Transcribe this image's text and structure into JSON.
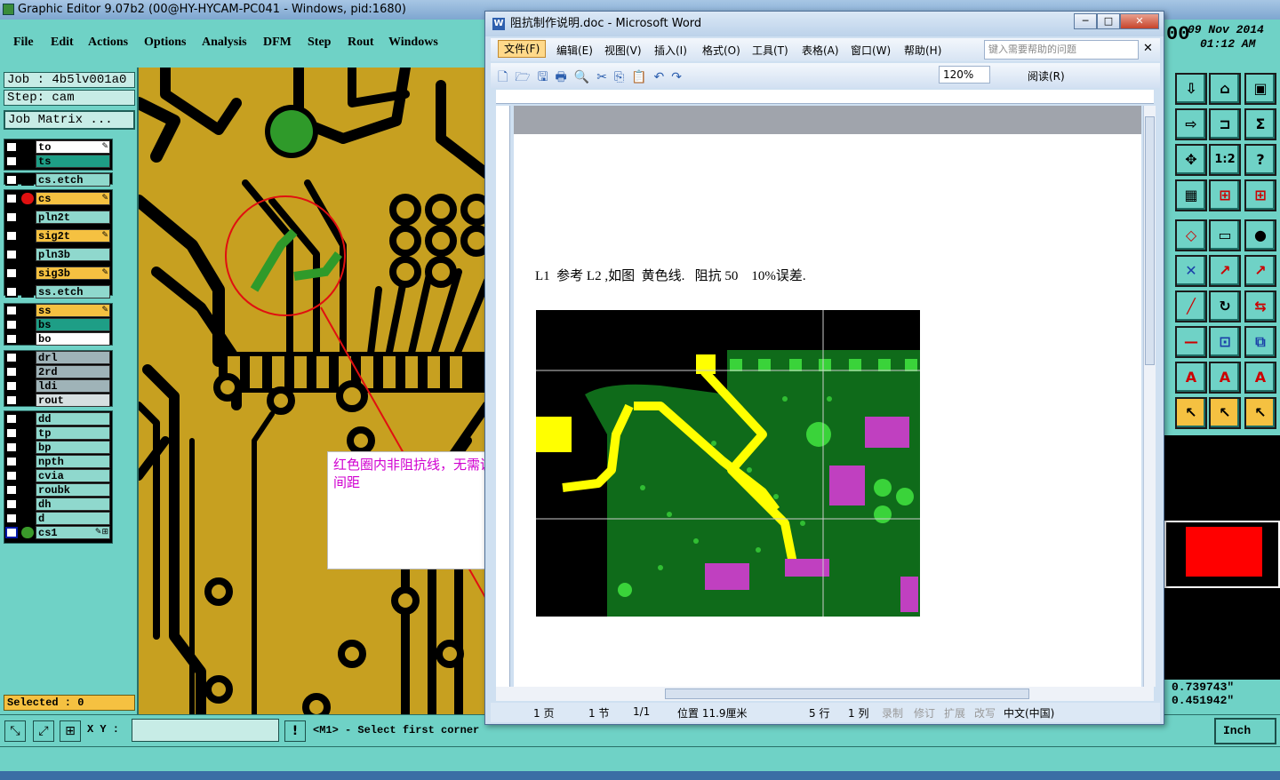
{
  "genesis": {
    "title": "Graphic Editor 9.07b2 (00@HY-HYCAM-PC041 - Windows, pid:1680)",
    "menu": [
      "File",
      "Edit",
      "Actions",
      "Options",
      "Analysis",
      "DFM",
      "Step",
      "Rout",
      "Windows"
    ],
    "job": "Job : 4b5lv001a0",
    "step": "Step: cam",
    "job_matrix": "Job Matrix ...",
    "layers": [
      "to",
      "ts",
      "cs.etch",
      "cs",
      "pln2t",
      "sig2t",
      "pln3b",
      "sig3b",
      "ss.etch",
      "ss",
      "bs",
      "bo",
      "drl",
      "2rd",
      "ldi",
      "rout",
      "dd",
      "tp",
      "bp",
      "npth",
      "cvia",
      "roubk",
      "dh",
      "d",
      "cs1"
    ],
    "selected": "Selected : 0",
    "xy_label": "X Y :",
    "xy_value": "",
    "prompt": "<M1> - Select first corner",
    "date": "09 Nov 2014",
    "time": "01:12 AM",
    "clock_frag": "00",
    "coord_x": "0.739743\"",
    "coord_y": "0.451942\"",
    "unit": "Inch"
  },
  "word": {
    "title": "阻抗制作说明.doc - Microsoft Word",
    "menu": [
      "文件(F)",
      "编辑(E)",
      "视图(V)",
      "插入(I)",
      "格式(O)",
      "工具(T)",
      "表格(A)",
      "窗口(W)",
      "帮助(H)"
    ],
    "help_placeholder": "键入需要帮助的问题",
    "zoom": "120%",
    "read_btn": "阅读(R)",
    "doc_line": "L1  参考 L2 ,如图  黄色线.   阻抗 50    10%误差.",
    "status": [
      "1 页",
      "1 节",
      "1/1",
      "位置 11.9厘米",
      "5 行",
      "1 列",
      "录制",
      "修订",
      "扩展",
      "改写",
      "中文(中国)"
    ]
  },
  "callout": "红色圈内非阻抗线，无需调整共面地间距",
  "colors": {
    "copper": "#c7a020",
    "accent": "#f5c141",
    "panel": "#6fd2c6"
  }
}
